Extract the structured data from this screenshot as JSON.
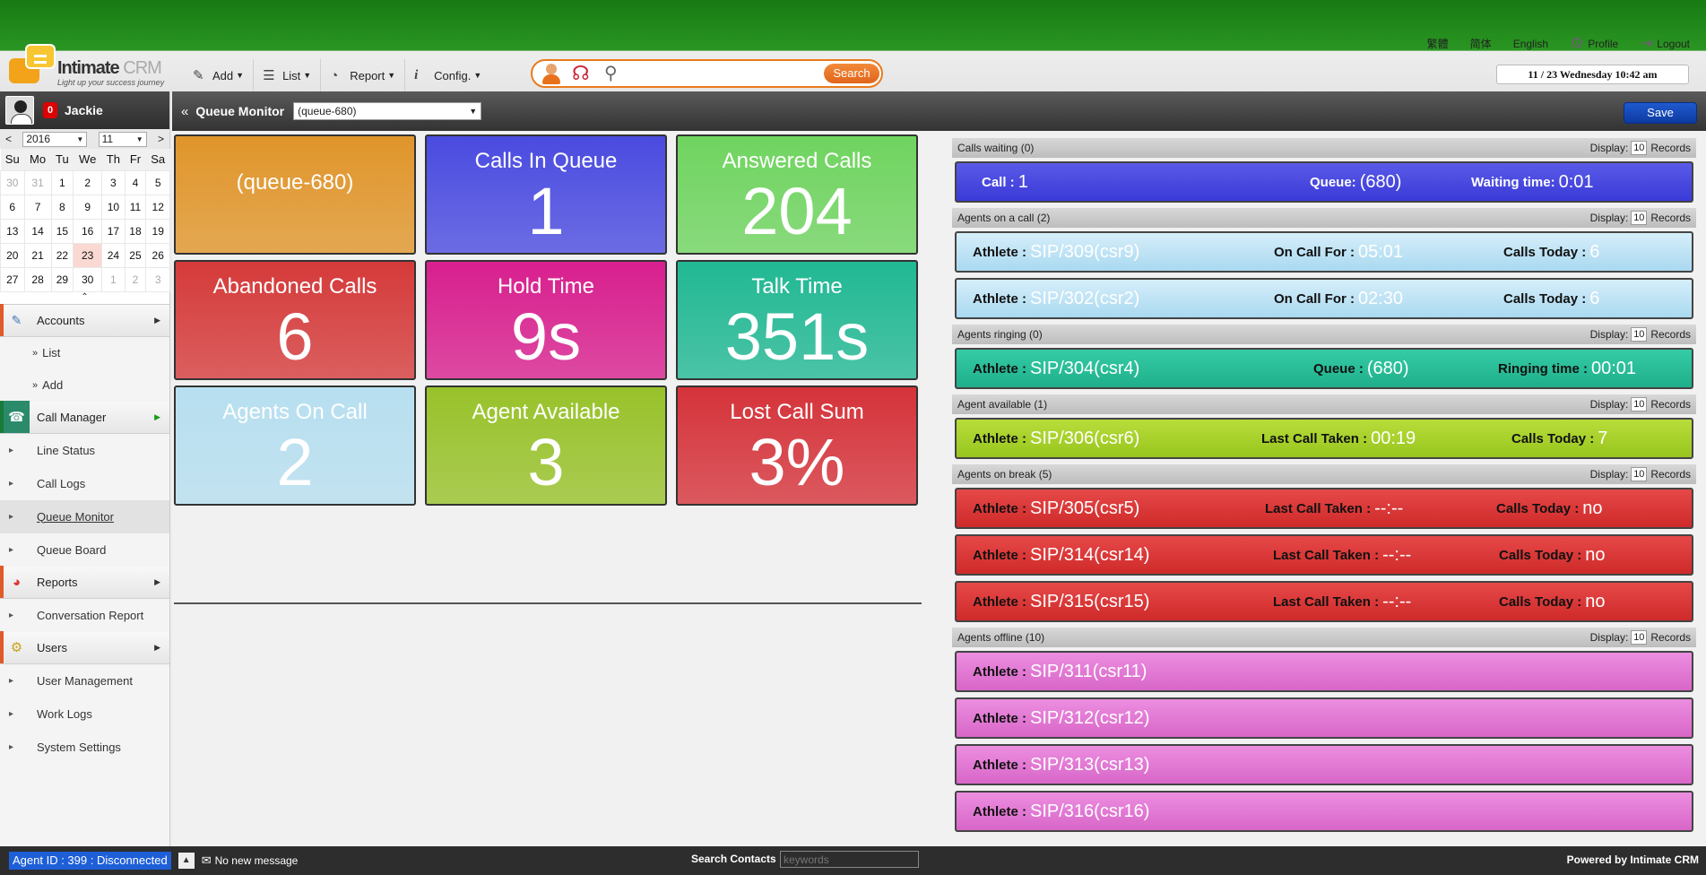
{
  "header": {
    "brand": "Intimate",
    "brand_suffix": "CRM",
    "tagline": "Light up your success journey",
    "nav": [
      {
        "label": "Add",
        "icon": "edit-icon"
      },
      {
        "label": "List",
        "icon": "list-icon"
      },
      {
        "label": "Report",
        "icon": "report-icon"
      },
      {
        "label": "Config.",
        "icon": "info-icon"
      }
    ],
    "search_button": "Search",
    "search_value": "",
    "lang_trad": "繁體",
    "lang_simp": "简体",
    "lang_en": "English",
    "profile": "Profile",
    "logout": "Logout",
    "datetime": "11 / 23  Wednesday  10:42 am"
  },
  "user": {
    "name": "Jackie",
    "badge": "0"
  },
  "calendar": {
    "prev": "<",
    "next": ">",
    "year": "2016",
    "month": "11",
    "weekdays": [
      "Su",
      "Mo",
      "Tu",
      "We",
      "Th",
      "Fr",
      "Sa"
    ],
    "weeks": [
      [
        "30",
        "31",
        "1",
        "2",
        "3",
        "4",
        "5"
      ],
      [
        "6",
        "7",
        "8",
        "9",
        "10",
        "11",
        "12"
      ],
      [
        "13",
        "14",
        "15",
        "16",
        "17",
        "18",
        "19"
      ],
      [
        "20",
        "21",
        "22",
        "23",
        "24",
        "25",
        "26"
      ],
      [
        "27",
        "28",
        "29",
        "30",
        "1",
        "2",
        "3"
      ]
    ]
  },
  "menu": {
    "accounts": "Accounts",
    "accounts_list": "List",
    "accounts_add": "Add",
    "call_manager": "Call Manager",
    "line_status": "Line Status",
    "call_logs": "Call Logs",
    "queue_monitor": "Queue Monitor",
    "queue_board": "Queue Board",
    "reports": "Reports",
    "conversation_report": "Conversation Report",
    "users": "Users",
    "user_management": "User Management",
    "work_logs": "Work Logs",
    "system_settings": "System Settings"
  },
  "main": {
    "title": "Queue Monitor",
    "queue_select": "(queue-680)",
    "save": "Save"
  },
  "tiles": {
    "queue": {
      "value": "(queue-680)",
      "color": "#e0952a"
    },
    "calls_in_queue": {
      "label": "Calls In Queue",
      "value": "1",
      "color": "#4a4be0"
    },
    "answered_calls": {
      "label": "Answered Calls",
      "value": "204",
      "color": "#6fd45f"
    },
    "abandoned_calls": {
      "label": "Abandoned Calls",
      "value": "6",
      "color": "#d53a3a"
    },
    "hold_time": {
      "label": "Hold Time",
      "value": "9s",
      "color": "#d81f8e"
    },
    "talk_time": {
      "label": "Talk Time",
      "value": "351s",
      "color": "#21b893"
    },
    "agents_on_call": {
      "label": "Agents On Call",
      "value": "2",
      "color": "#b7dff0"
    },
    "agent_available": {
      "label": "Agent Available",
      "value": "3",
      "color": "#98c22a"
    },
    "lost_call_sum": {
      "label": "Lost Call Sum",
      "value": "3%",
      "color": "#d5333a"
    }
  },
  "sections": {
    "display": "Display:",
    "records": "Records",
    "count": "10",
    "waiting": {
      "title": "Calls waiting (0)",
      "call_label": "Call :",
      "call_value": "1",
      "queue_label": "Queue:",
      "queue_value": "(680)",
      "wait_label": "Waiting time:",
      "wait_value": "0:01"
    },
    "on_call": {
      "title": "Agents on a call (2)",
      "athlete_label": "Athlete :",
      "oncall_label": "On Call For :",
      "calls_today_label": "Calls Today :",
      "rows": [
        {
          "agent": "SIP/309(csr9)",
          "duration": "05:01",
          "calls": "6"
        },
        {
          "agent": "SIP/302(csr2)",
          "duration": "02:30",
          "calls": "6"
        }
      ]
    },
    "ringing": {
      "title": "Agents ringing (0)",
      "athlete_label": "Athlete :",
      "agent": "SIP/304(csr4)",
      "queue_label": "Queue :",
      "queue_value": "(680)",
      "ring_label": "Ringing time :",
      "ring_value": "00:01"
    },
    "available": {
      "title": "Agent available (1)",
      "athlete_label": "Athlete :",
      "agent": "SIP/306(csr6)",
      "last_label": "Last Call Taken :",
      "last_value": "00:19",
      "calls_label": "Calls Today :",
      "calls_value": "7"
    },
    "on_break": {
      "title": "Agents on break (5)",
      "athlete_label": "Athlete :",
      "last_label": "Last Call Taken :",
      "calls_label": "Calls Today :",
      "rows": [
        {
          "agent": "SIP/305(csr5)",
          "last": "--:--",
          "calls": "no"
        },
        {
          "agent": "SIP/314(csr14)",
          "last": "--:--",
          "calls": "no"
        },
        {
          "agent": "SIP/315(csr15)",
          "last": "--:--",
          "calls": "no"
        }
      ]
    },
    "offline": {
      "title": "Agents offline (10)",
      "athlete_label": "Athlete :",
      "rows": [
        "SIP/311(csr11)",
        "SIP/312(csr12)",
        "SIP/313(csr13)",
        "SIP/316(csr16)"
      ]
    }
  },
  "footer": {
    "agent_status": "Agent ID : 399 : Disconnected",
    "up": "▲",
    "message": "No new message",
    "search_contacts_label": "Search Contacts :",
    "search_placeholder": "keywords",
    "powered": "Powered by Intimate CRM"
  }
}
